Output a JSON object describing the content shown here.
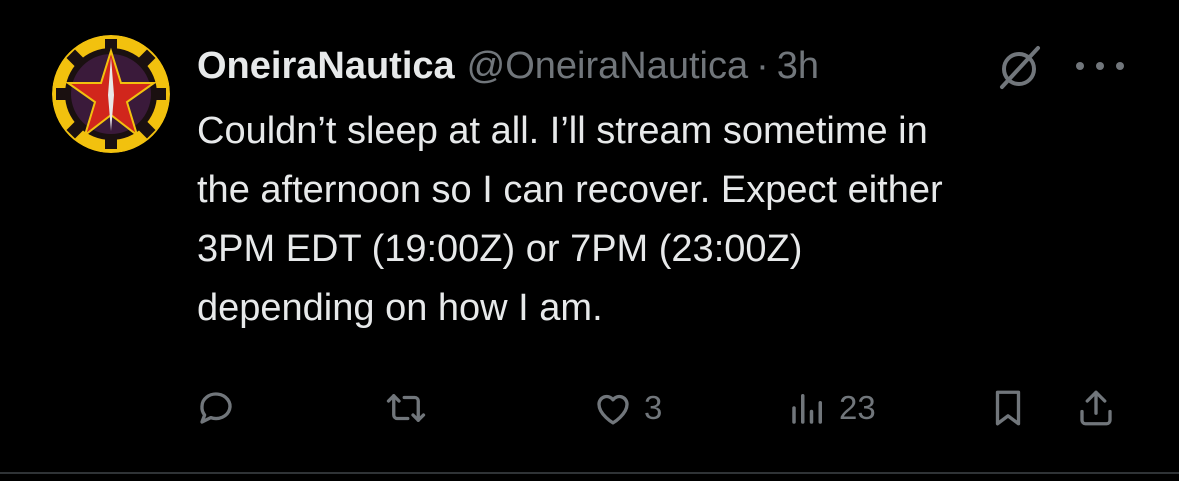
{
  "tweet": {
    "author_name": "OneiraNautica",
    "handle": "@OneiraNautica",
    "separator": "·",
    "time": "3h",
    "text": "Couldn’t sleep at all. I’ll stream sometime in\nthe afternoon so I can recover. Expect either\n3PM EDT (19:00Z) or 7PM (23:00Z)\ndepending on how I am."
  },
  "actions": {
    "reply_count": "",
    "retweet_count": "",
    "like_count": "3",
    "views_count": "23"
  },
  "icons": [
    "avatar",
    "grok-icon",
    "more-icon",
    "reply-icon",
    "retweet-icon",
    "like-icon",
    "views-icon",
    "bookmark-icon",
    "share-icon"
  ],
  "colors": {
    "background": "#000000",
    "text": "#e7e9ea",
    "secondary": "#71767b",
    "divider": "#2f3336"
  }
}
